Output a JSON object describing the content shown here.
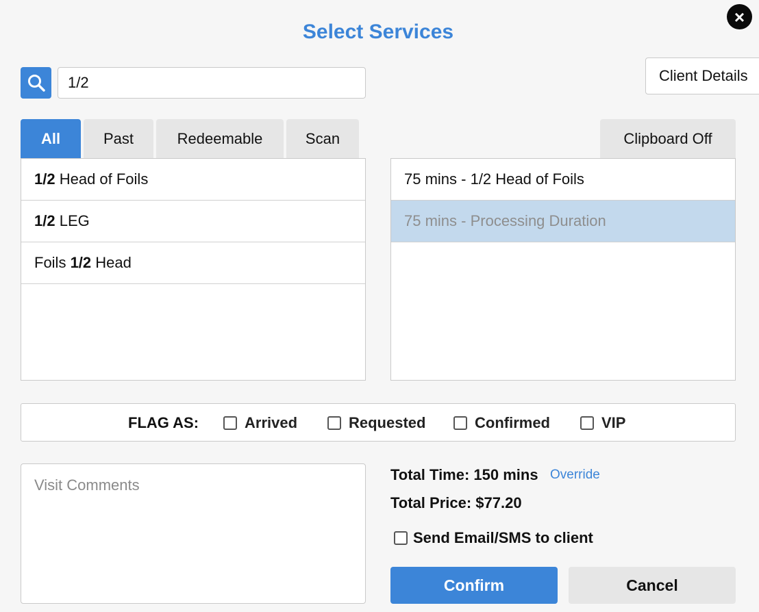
{
  "title": "Select Services",
  "close_icon": "close-icon",
  "search": {
    "icon": "search-icon",
    "value": "1/2"
  },
  "client_details_label": "Client Details",
  "tabs": [
    {
      "label": "All",
      "active": true
    },
    {
      "label": "Past",
      "active": false
    },
    {
      "label": "Redeemable",
      "active": false
    },
    {
      "label": "Scan",
      "active": false
    }
  ],
  "clipboard_label": "Clipboard Off",
  "services": [
    {
      "pre": "",
      "match": "1/2",
      "post": " Head of Foils"
    },
    {
      "pre": "",
      "match": "1/2",
      "post": " LEG"
    },
    {
      "pre": "Foils ",
      "match": "1/2",
      "post": " Head"
    }
  ],
  "selected_services": [
    {
      "label": "75 mins - 1/2 Head of Foils",
      "highlighted": false
    },
    {
      "label": "75 mins - Processing Duration",
      "highlighted": true
    }
  ],
  "flags": {
    "label": "FLAG AS:",
    "options": [
      "Arrived",
      "Requested",
      "Confirmed",
      "VIP"
    ]
  },
  "comments_placeholder": "Visit Comments",
  "total_time": "Total Time: 150 mins",
  "override_label": "Override",
  "total_price": "Total Price: $77.20",
  "send_label": "Send Email/SMS to client",
  "confirm_label": "Confirm",
  "cancel_label": "Cancel",
  "colors": {
    "accent": "#3c85d8",
    "selected_row": "#c3d9ed",
    "tab_inactive": "#e6e6e6"
  }
}
